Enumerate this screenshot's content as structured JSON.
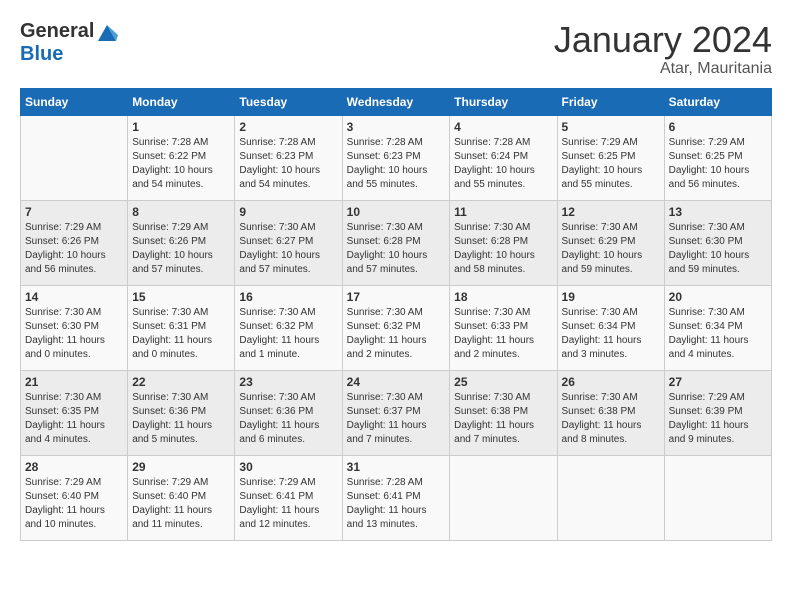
{
  "header": {
    "logo_general": "General",
    "logo_blue": "Blue",
    "month_title": "January 2024",
    "location": "Atar, Mauritania"
  },
  "days_of_week": [
    "Sunday",
    "Monday",
    "Tuesday",
    "Wednesday",
    "Thursday",
    "Friday",
    "Saturday"
  ],
  "weeks": [
    [
      {
        "day": "",
        "sunrise": "",
        "sunset": "",
        "daylight": ""
      },
      {
        "day": "1",
        "sunrise": "Sunrise: 7:28 AM",
        "sunset": "Sunset: 6:22 PM",
        "daylight": "Daylight: 10 hours and 54 minutes."
      },
      {
        "day": "2",
        "sunrise": "Sunrise: 7:28 AM",
        "sunset": "Sunset: 6:23 PM",
        "daylight": "Daylight: 10 hours and 54 minutes."
      },
      {
        "day": "3",
        "sunrise": "Sunrise: 7:28 AM",
        "sunset": "Sunset: 6:23 PM",
        "daylight": "Daylight: 10 hours and 55 minutes."
      },
      {
        "day": "4",
        "sunrise": "Sunrise: 7:28 AM",
        "sunset": "Sunset: 6:24 PM",
        "daylight": "Daylight: 10 hours and 55 minutes."
      },
      {
        "day": "5",
        "sunrise": "Sunrise: 7:29 AM",
        "sunset": "Sunset: 6:25 PM",
        "daylight": "Daylight: 10 hours and 55 minutes."
      },
      {
        "day": "6",
        "sunrise": "Sunrise: 7:29 AM",
        "sunset": "Sunset: 6:25 PM",
        "daylight": "Daylight: 10 hours and 56 minutes."
      }
    ],
    [
      {
        "day": "7",
        "sunrise": "Sunrise: 7:29 AM",
        "sunset": "Sunset: 6:26 PM",
        "daylight": "Daylight: 10 hours and 56 minutes."
      },
      {
        "day": "8",
        "sunrise": "Sunrise: 7:29 AM",
        "sunset": "Sunset: 6:26 PM",
        "daylight": "Daylight: 10 hours and 57 minutes."
      },
      {
        "day": "9",
        "sunrise": "Sunrise: 7:30 AM",
        "sunset": "Sunset: 6:27 PM",
        "daylight": "Daylight: 10 hours and 57 minutes."
      },
      {
        "day": "10",
        "sunrise": "Sunrise: 7:30 AM",
        "sunset": "Sunset: 6:28 PM",
        "daylight": "Daylight: 10 hours and 57 minutes."
      },
      {
        "day": "11",
        "sunrise": "Sunrise: 7:30 AM",
        "sunset": "Sunset: 6:28 PM",
        "daylight": "Daylight: 10 hours and 58 minutes."
      },
      {
        "day": "12",
        "sunrise": "Sunrise: 7:30 AM",
        "sunset": "Sunset: 6:29 PM",
        "daylight": "Daylight: 10 hours and 59 minutes."
      },
      {
        "day": "13",
        "sunrise": "Sunrise: 7:30 AM",
        "sunset": "Sunset: 6:30 PM",
        "daylight": "Daylight: 10 hours and 59 minutes."
      }
    ],
    [
      {
        "day": "14",
        "sunrise": "Sunrise: 7:30 AM",
        "sunset": "Sunset: 6:30 PM",
        "daylight": "Daylight: 11 hours and 0 minutes."
      },
      {
        "day": "15",
        "sunrise": "Sunrise: 7:30 AM",
        "sunset": "Sunset: 6:31 PM",
        "daylight": "Daylight: 11 hours and 0 minutes."
      },
      {
        "day": "16",
        "sunrise": "Sunrise: 7:30 AM",
        "sunset": "Sunset: 6:32 PM",
        "daylight": "Daylight: 11 hours and 1 minute."
      },
      {
        "day": "17",
        "sunrise": "Sunrise: 7:30 AM",
        "sunset": "Sunset: 6:32 PM",
        "daylight": "Daylight: 11 hours and 2 minutes."
      },
      {
        "day": "18",
        "sunrise": "Sunrise: 7:30 AM",
        "sunset": "Sunset: 6:33 PM",
        "daylight": "Daylight: 11 hours and 2 minutes."
      },
      {
        "day": "19",
        "sunrise": "Sunrise: 7:30 AM",
        "sunset": "Sunset: 6:34 PM",
        "daylight": "Daylight: 11 hours and 3 minutes."
      },
      {
        "day": "20",
        "sunrise": "Sunrise: 7:30 AM",
        "sunset": "Sunset: 6:34 PM",
        "daylight": "Daylight: 11 hours and 4 minutes."
      }
    ],
    [
      {
        "day": "21",
        "sunrise": "Sunrise: 7:30 AM",
        "sunset": "Sunset: 6:35 PM",
        "daylight": "Daylight: 11 hours and 4 minutes."
      },
      {
        "day": "22",
        "sunrise": "Sunrise: 7:30 AM",
        "sunset": "Sunset: 6:36 PM",
        "daylight": "Daylight: 11 hours and 5 minutes."
      },
      {
        "day": "23",
        "sunrise": "Sunrise: 7:30 AM",
        "sunset": "Sunset: 6:36 PM",
        "daylight": "Daylight: 11 hours and 6 minutes."
      },
      {
        "day": "24",
        "sunrise": "Sunrise: 7:30 AM",
        "sunset": "Sunset: 6:37 PM",
        "daylight": "Daylight: 11 hours and 7 minutes."
      },
      {
        "day": "25",
        "sunrise": "Sunrise: 7:30 AM",
        "sunset": "Sunset: 6:38 PM",
        "daylight": "Daylight: 11 hours and 7 minutes."
      },
      {
        "day": "26",
        "sunrise": "Sunrise: 7:30 AM",
        "sunset": "Sunset: 6:38 PM",
        "daylight": "Daylight: 11 hours and 8 minutes."
      },
      {
        "day": "27",
        "sunrise": "Sunrise: 7:29 AM",
        "sunset": "Sunset: 6:39 PM",
        "daylight": "Daylight: 11 hours and 9 minutes."
      }
    ],
    [
      {
        "day": "28",
        "sunrise": "Sunrise: 7:29 AM",
        "sunset": "Sunset: 6:40 PM",
        "daylight": "Daylight: 11 hours and 10 minutes."
      },
      {
        "day": "29",
        "sunrise": "Sunrise: 7:29 AM",
        "sunset": "Sunset: 6:40 PM",
        "daylight": "Daylight: 11 hours and 11 minutes."
      },
      {
        "day": "30",
        "sunrise": "Sunrise: 7:29 AM",
        "sunset": "Sunset: 6:41 PM",
        "daylight": "Daylight: 11 hours and 12 minutes."
      },
      {
        "day": "31",
        "sunrise": "Sunrise: 7:28 AM",
        "sunset": "Sunset: 6:41 PM",
        "daylight": "Daylight: 11 hours and 13 minutes."
      },
      {
        "day": "",
        "sunrise": "",
        "sunset": "",
        "daylight": ""
      },
      {
        "day": "",
        "sunrise": "",
        "sunset": "",
        "daylight": ""
      },
      {
        "day": "",
        "sunrise": "",
        "sunset": "",
        "daylight": ""
      }
    ]
  ]
}
